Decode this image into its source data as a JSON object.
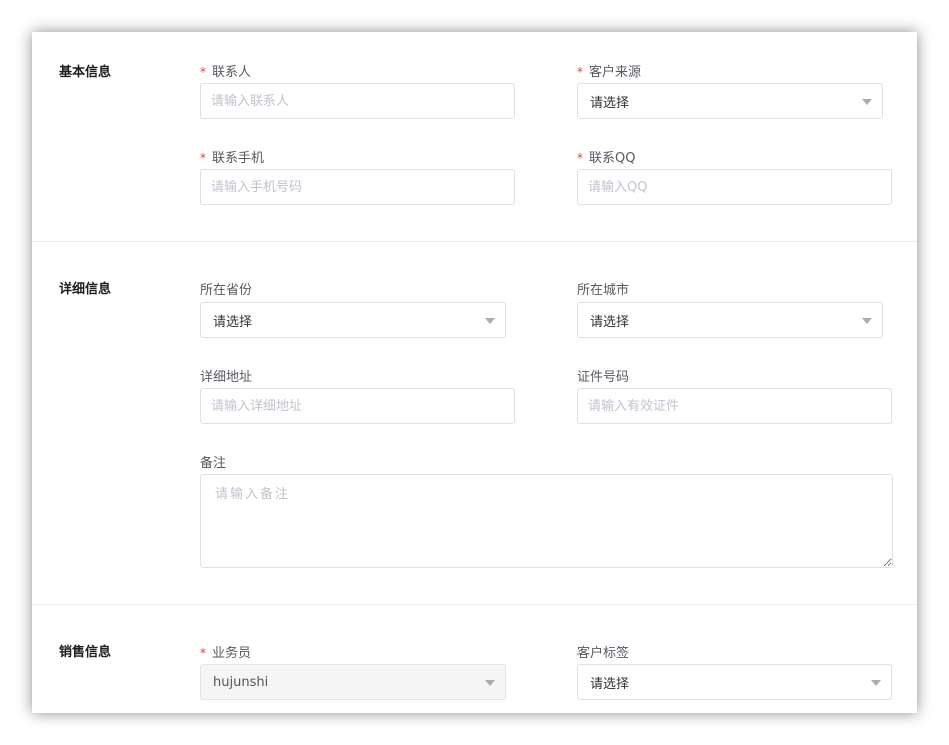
{
  "sections": {
    "basic": {
      "title": "基本信息",
      "contact": {
        "label": "联系人",
        "required": "*",
        "placeholder": "请输入联系人"
      },
      "source": {
        "label": "客户来源",
        "required": "*",
        "value": "请选择"
      },
      "phone": {
        "label": "联系手机",
        "required": "*",
        "placeholder": "请输入手机号码"
      },
      "qq": {
        "label": "联系QQ",
        "required": "*",
        "placeholder": "请输入QQ"
      }
    },
    "detail": {
      "title": "详细信息",
      "province": {
        "label": "所在省份",
        "value": "请选择"
      },
      "city": {
        "label": "所在城市",
        "value": "请选择"
      },
      "address": {
        "label": "详细地址",
        "placeholder": "请输入详细地址"
      },
      "id_number": {
        "label": "证件号码",
        "placeholder": "请输入有效证件"
      },
      "remark": {
        "label": "备注",
        "placeholder": "请输入备注"
      }
    },
    "sales": {
      "title": "销售信息",
      "salesperson": {
        "label": "业务员",
        "required": "*",
        "value": "hujunshi"
      },
      "tags": {
        "label": "客户标签",
        "value": "请选择"
      }
    }
  },
  "icons": {
    "dropdown": "chevron-down-icon"
  },
  "colors": {
    "required": "#e23c3c",
    "border": "#dde1e6",
    "placeholder": "#c0c4cc"
  }
}
